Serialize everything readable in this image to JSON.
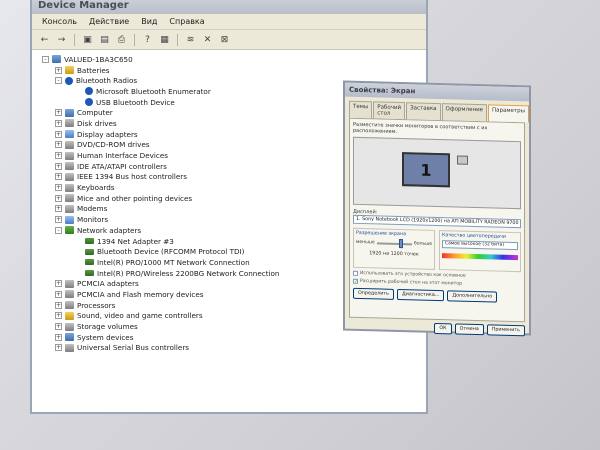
{
  "device_manager": {
    "title": "Device Manager",
    "menu": [
      "Консоль",
      "Действие",
      "Вид",
      "Справка"
    ],
    "toolbar": [
      "back-arrow-icon",
      "forward-arrow-icon",
      "properties-icon",
      "tree-icon",
      "print-icon",
      "help-icon",
      "scan-icon",
      "update-driver-icon",
      "disable-icon",
      "uninstall-icon"
    ],
    "tree": [
      {
        "label": "VALUED-1BA3C650",
        "level": 0,
        "expander": "-",
        "icon": "computer"
      },
      {
        "label": "Batteries",
        "level": 1,
        "expander": "+",
        "icon": "yellow"
      },
      {
        "label": "Bluetooth Radios",
        "level": 1,
        "expander": "-",
        "icon": "bt"
      },
      {
        "label": "Microsoft Bluetooth Enumerator",
        "level": 2,
        "expander": "",
        "icon": "bt"
      },
      {
        "label": "USB Bluetooth Device",
        "level": 2,
        "expander": "",
        "icon": "bt"
      },
      {
        "label": "Computer",
        "level": 1,
        "expander": "+",
        "icon": "computer"
      },
      {
        "label": "Disk drives",
        "level": 1,
        "expander": "+",
        "icon": "gray"
      },
      {
        "label": "Display adapters",
        "level": 1,
        "expander": "+",
        "icon": "blue"
      },
      {
        "label": "DVD/CD-ROM drives",
        "level": 1,
        "expander": "+",
        "icon": "gray"
      },
      {
        "label": "Human Interface Devices",
        "level": 1,
        "expander": "+",
        "icon": "gray"
      },
      {
        "label": "IDE ATA/ATAPI controllers",
        "level": 1,
        "expander": "+",
        "icon": "gray"
      },
      {
        "label": "IEEE 1394 Bus host controllers",
        "level": 1,
        "expander": "+",
        "icon": "gray"
      },
      {
        "label": "Keyboards",
        "level": 1,
        "expander": "+",
        "icon": "gray"
      },
      {
        "label": "Mice and other pointing devices",
        "level": 1,
        "expander": "+",
        "icon": "gray"
      },
      {
        "label": "Modems",
        "level": 1,
        "expander": "+",
        "icon": "gray"
      },
      {
        "label": "Monitors",
        "level": 1,
        "expander": "+",
        "icon": "blue"
      },
      {
        "label": "Network adapters",
        "level": 1,
        "expander": "-",
        "icon": "green"
      },
      {
        "label": "1394 Net Adapter #3",
        "level": 2,
        "expander": "",
        "icon": "net"
      },
      {
        "label": "Bluetooth Device (RFCOMM Protocol TDI)",
        "level": 2,
        "expander": "",
        "icon": "net"
      },
      {
        "label": "Intel(R) PRO/1000 MT Network Connection",
        "level": 2,
        "expander": "",
        "icon": "net"
      },
      {
        "label": "Intel(R) PRO/Wireless 2200BG Network Connection",
        "level": 2,
        "expander": "",
        "icon": "net"
      },
      {
        "label": "PCMCIA adapters",
        "level": 1,
        "expander": "+",
        "icon": "gray"
      },
      {
        "label": "PCMCIA and Flash memory devices",
        "level": 1,
        "expander": "+",
        "icon": "gray"
      },
      {
        "label": "Processors",
        "level": 1,
        "expander": "+",
        "icon": "gray"
      },
      {
        "label": "Sound, video and game controllers",
        "level": 1,
        "expander": "+",
        "icon": "yellow"
      },
      {
        "label": "Storage volumes",
        "level": 1,
        "expander": "+",
        "icon": "gray"
      },
      {
        "label": "System devices",
        "level": 1,
        "expander": "+",
        "icon": "computer"
      },
      {
        "label": "Universal Serial Bus controllers",
        "level": 1,
        "expander": "+",
        "icon": "gray"
      }
    ]
  },
  "display_properties": {
    "title": "Свойства: Экран",
    "tabs": [
      "Темы",
      "Рабочий стол",
      "Заставка",
      "Оформление",
      "Параметры"
    ],
    "active_tab": "Параметры",
    "instruction": "Разместите значки мониторов в соответствии с их расположением.",
    "monitor_label": "1",
    "display_label": "Дисплей:",
    "display_value": "1. Sony Notebook LCD (1920x1200) на ATI MOBILITY RADEON 9700",
    "resolution_title": "Разрешение экрана",
    "slider_min": "меньше",
    "slider_max": "больше",
    "slider_position": 0.62,
    "resolution_value": "1920 на 1200 точек",
    "quality_title": "Качество цветопередачи",
    "quality_value": "Самое высокое (32 бита)",
    "checkbox_primary": "Использовать это устройство как основное",
    "checkbox_extend": "Расширить рабочий стол на этот монитор",
    "btn_identify": "Определить",
    "btn_troubleshoot": "Диагностика...",
    "btn_advanced": "Дополнительно",
    "btn_ok": "ОК",
    "btn_cancel": "Отмена",
    "btn_apply": "Применить"
  }
}
